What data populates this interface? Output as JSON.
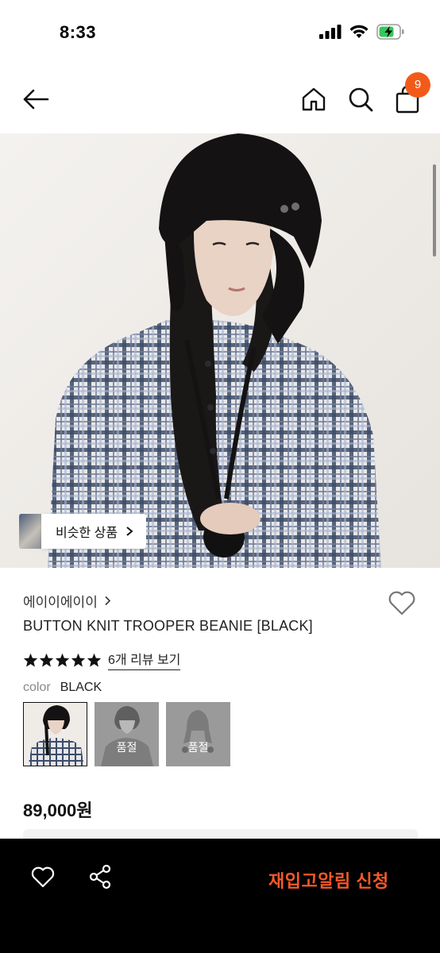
{
  "status_bar": {
    "time": "8:33",
    "icons": [
      "cellular-signal-icon",
      "wifi-icon",
      "battery-charging-icon"
    ]
  },
  "nav": {
    "icons": [
      "back-arrow-icon",
      "home-icon",
      "search-icon",
      "shopping-bag-icon"
    ],
    "cart_count": "9"
  },
  "hero": {
    "similar_products_label": "비슷한 상품"
  },
  "product": {
    "brand": "에이이에이이",
    "name": "BUTTON KNIT TROOPER BEANIE [BLACK]",
    "rating_stars": 5,
    "review_link": "6개 리뷰 보기",
    "color_label": "color",
    "color_value": "BLACK",
    "swatches": [
      {
        "selected": true,
        "sold_out": false
      },
      {
        "selected": false,
        "sold_out": true,
        "label": "품절"
      },
      {
        "selected": false,
        "sold_out": true,
        "label": "품절"
      }
    ],
    "price": "89,000원"
  },
  "bottom_bar": {
    "restock_label": "재입고알림 신청"
  },
  "colors": {
    "accent": "#f25a1a",
    "restock_text": "#f2592b",
    "star": "#111111",
    "bottom_bar_bg": "#000000"
  }
}
